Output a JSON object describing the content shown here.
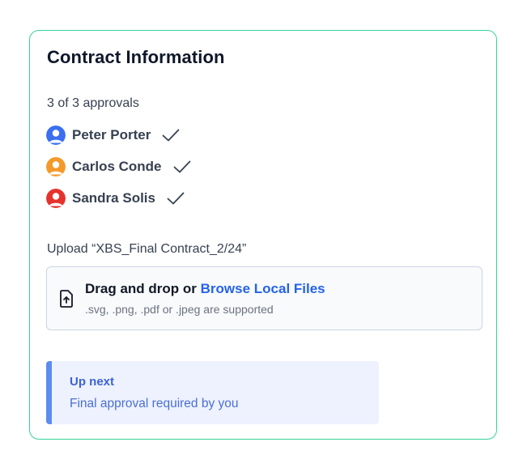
{
  "card": {
    "title": "Contract Information",
    "approvals_count": "3 of 3 approvals",
    "approvers": [
      {
        "name": "Peter Porter",
        "avatar_color": "#3b6ff0",
        "icon": "user-avatar-icon",
        "status_icon": "check-icon"
      },
      {
        "name": "Carlos Conde",
        "avatar_color": "#f39a2b",
        "icon": "user-avatar-icon",
        "status_icon": "check-icon"
      },
      {
        "name": "Sandra Solis",
        "avatar_color": "#e5322d",
        "icon": "user-avatar-icon",
        "status_icon": "check-icon"
      }
    ],
    "upload": {
      "label": "Upload “XBS_Final Contract_2/24”",
      "drop_text": "Drag and drop or",
      "browse_link": "Browse Local Files",
      "hint": ".svg, .png, .pdf or .jpeg are supported",
      "icon": "file-upload-icon"
    },
    "up_next": {
      "title": "Up next",
      "text": "Final approval required by you"
    }
  },
  "colors": {
    "card_border": "#34d399",
    "link": "#2563eb",
    "callout_bg": "#eef2ff",
    "callout_accent": "#5b8def"
  }
}
